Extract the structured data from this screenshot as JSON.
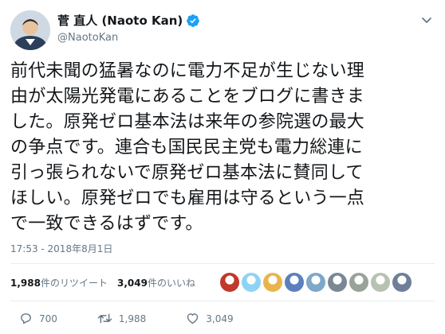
{
  "author": {
    "display_name": "菅 直人 (Naoto Kan)",
    "handle": "@NaotoKan",
    "verified": true,
    "avatar_icon": "profile-photo"
  },
  "tweet": {
    "text": "前代未聞の猛暑なのに電力不足が生じない理\n由が太陽光発電にあることをブログに書きま\nした。原発ゼロ基本法は来年の参院選の最大\nの争点です。連合も国民民主党も電力総連に\n引っ張られないで原発ゼロ基本法に賛同して\nほしい。原発ゼロでも雇用は守るという一点\nで一致できるはずです。",
    "timestamp": "17:53 - 2018年8月1日"
  },
  "stats": {
    "retweets_count": "1,988",
    "retweets_label": "件のリツイート",
    "likes_count": "3,049",
    "likes_label": "件のいいね"
  },
  "likers": [
    {
      "color": "#c0392b"
    },
    {
      "color": "#8fd3f4"
    },
    {
      "color": "#e9b44c"
    },
    {
      "color": "#5b7fbf"
    },
    {
      "color": "#7ea7c9"
    },
    {
      "color": "#7a8794"
    },
    {
      "color": "#9aa39a"
    },
    {
      "color": "#b7c2b2"
    },
    {
      "color": "#6f7f99"
    }
  ],
  "actions": {
    "reply_count": "700",
    "retweet_count": "1,988",
    "like_count": "3,049"
  },
  "colors": {
    "verified": "#1da1f2",
    "muted": "#657786",
    "text": "#14171a"
  }
}
